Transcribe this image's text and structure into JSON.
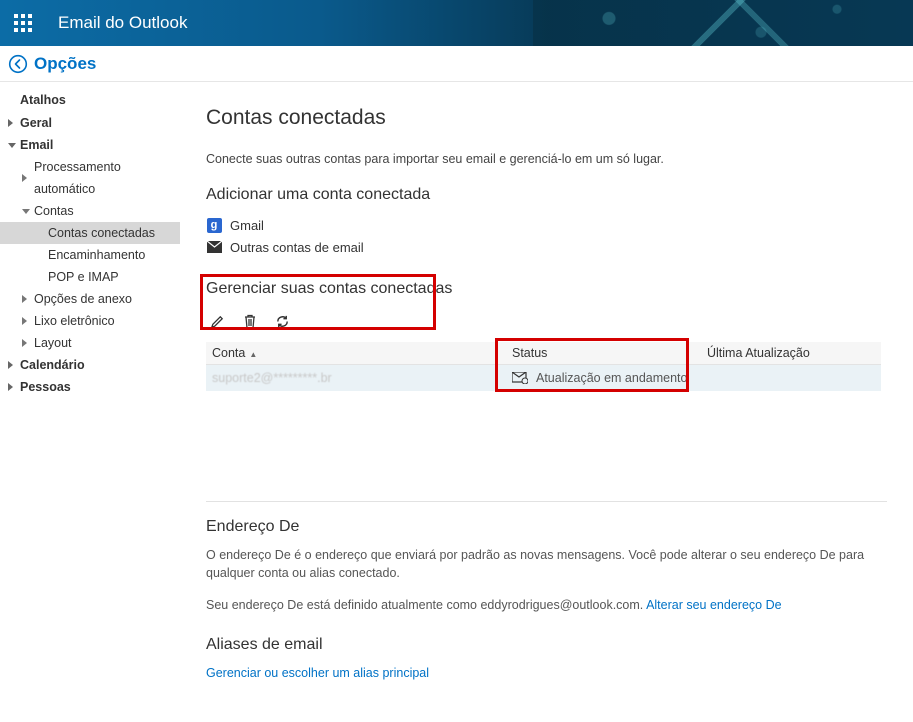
{
  "header": {
    "app_title": "Email do Outlook"
  },
  "subheader": {
    "options_label": "Opções"
  },
  "sidebar": {
    "shortcuts": "Atalhos",
    "general": "Geral",
    "email": "Email",
    "auto_processing": "Processamento automático",
    "accounts": "Contas",
    "connected_accounts": "Contas conectadas",
    "forwarding": "Encaminhamento",
    "pop_imap": "POP e IMAP",
    "attach_options": "Opções de anexo",
    "junk": "Lixo eletrônico",
    "layout": "Layout",
    "calendar": "Calendário",
    "people": "Pessoas"
  },
  "main": {
    "title": "Contas conectadas",
    "description": "Conecte suas outras contas para importar seu email e gerenciá-lo em um só lugar.",
    "add_heading": "Adicionar uma conta conectada",
    "add_gmail": "Gmail",
    "add_other": "Outras contas de email",
    "manage_heading": "Gerenciar suas contas conectadas",
    "table": {
      "col_account": "Conta",
      "col_status": "Status",
      "col_updated": "Última Atualização",
      "row": {
        "account": "suporte2@*********.br",
        "status": "Atualização em andamento",
        "updated": ""
      }
    },
    "from_heading": "Endereço De",
    "from_para": "O endereço De é o endereço que enviará por padrão as novas mensagens. Você pode alterar o seu endereço De para qualquer conta ou alias conectado.",
    "from_current_prefix": "Seu endereço De está definido atualmente como ",
    "from_email": "eddyrodrigues@outlook.com",
    "from_current_suffix": ". ",
    "from_change_link": "Alterar seu endereço De",
    "aliases_heading": "Aliases de email",
    "aliases_link": "Gerenciar ou escolher um alias principal"
  }
}
